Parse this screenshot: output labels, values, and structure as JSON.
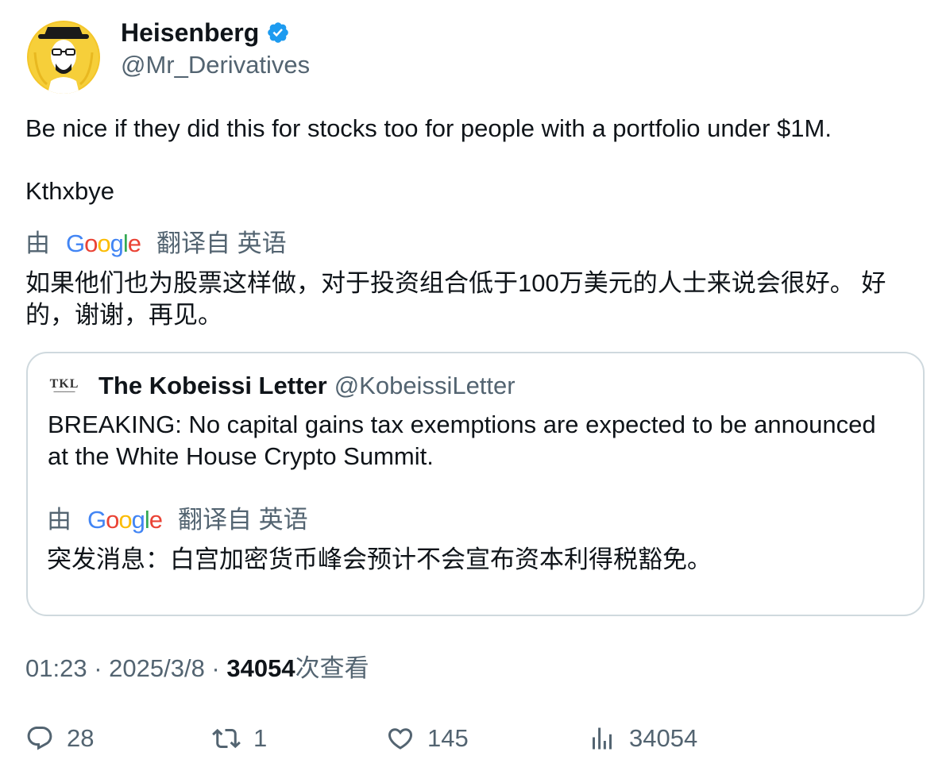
{
  "tweet": {
    "author_name": "Heisenberg",
    "author_handle": "@Mr_Derivatives",
    "text_line1": "Be nice if they did this for stocks too for people with a portfolio under $1M.",
    "text_line2": "Kthxbye",
    "translation": {
      "prefix": "由",
      "provider": "Google",
      "suffix": "翻译自 英语",
      "text_line1": "如果他们也为股票这样做，对于投资组合低于100万美元的人士来说会很好。 好",
      "text_line2": "的，谢谢，再见。"
    }
  },
  "quote": {
    "avatar_text": "TKL",
    "author_name": "The Kobeissi Letter",
    "author_handle": "@KobeissiLetter",
    "text_line1": "BREAKING: No capital gains tax exemptions are expected to be announced",
    "text_line2": "at the White House Crypto Summit.",
    "translation": {
      "prefix": "由",
      "provider": "Google",
      "suffix": "翻译自 英语",
      "text": "突发消息：白宫加密货币峰会预计不会宣布资本利得税豁免。"
    }
  },
  "meta": {
    "time": "01:23",
    "separator": " · ",
    "date": "2025/3/8",
    "views_count": "34054",
    "views_label": "次查看"
  },
  "actions": {
    "replies": "28",
    "retweets": "1",
    "likes": "145",
    "views": "34054"
  },
  "colors": {
    "verified": "#1d9bf0",
    "secondary_text": "#536471",
    "primary_text": "#0f1419",
    "border": "#cfd9de",
    "google_blue": "#4285F4",
    "google_red": "#EA4335",
    "google_yellow": "#FBBC05",
    "google_green": "#34A853"
  },
  "icons": {
    "verified": "verified-badge-icon",
    "reply": "reply-icon",
    "retweet": "retweet-icon",
    "like": "heart-icon",
    "views": "views-chart-icon"
  }
}
